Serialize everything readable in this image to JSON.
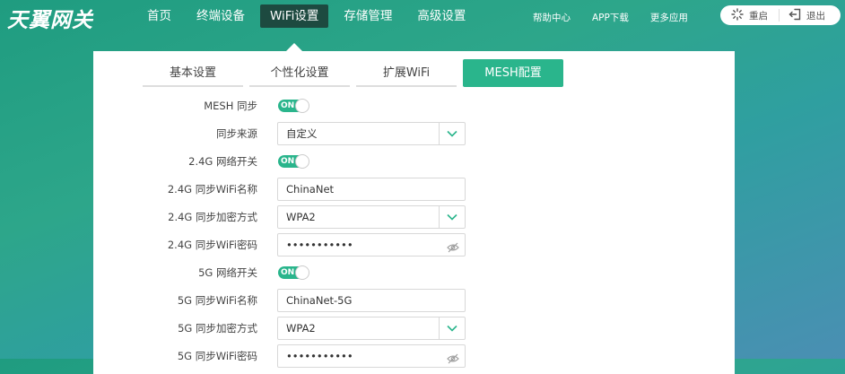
{
  "brand": {
    "logo": "天翼网关"
  },
  "nav": [
    {
      "label": "首页"
    },
    {
      "label": "终端设备"
    },
    {
      "label": "WiFi设置",
      "active": true
    },
    {
      "label": "存储管理"
    },
    {
      "label": "高级设置"
    }
  ],
  "links": [
    {
      "label": "帮助中心"
    },
    {
      "label": "APP下载"
    },
    {
      "label": "更多应用"
    }
  ],
  "actions": {
    "restart": "重启",
    "logout": "退出"
  },
  "tabs": [
    {
      "label": "基本设置"
    },
    {
      "label": "个性化设置"
    },
    {
      "label": "扩展WiFi"
    },
    {
      "label": "MESH配置",
      "active": true
    }
  ],
  "form": {
    "mesh_sync": {
      "label": "MESH 同步",
      "state": "ON"
    },
    "sync_source": {
      "label": "同步来源",
      "value": "自定义"
    },
    "wifi24_switch": {
      "label": "2.4G 网络开关",
      "state": "ON"
    },
    "wifi24_name": {
      "label": "2.4G 同步WiFi名称",
      "value": "ChinaNet"
    },
    "wifi24_enc": {
      "label": "2.4G 同步加密方式",
      "value": "WPA2"
    },
    "wifi24_pwd": {
      "label": "2.4G 同步WiFi密码",
      "value": "•••••••••••"
    },
    "wifi5_switch": {
      "label": "5G 网络开关",
      "state": "ON"
    },
    "wifi5_name": {
      "label": "5G 同步WiFi名称",
      "value": "ChinaNet-5G"
    },
    "wifi5_enc": {
      "label": "5G 同步加密方式",
      "value": "WPA2"
    },
    "wifi5_pwd": {
      "label": "5G 同步WiFi密码",
      "value": "•••••••••••"
    }
  },
  "colors": {
    "accent": "#2ab58c",
    "nav_active": "#1d4a40"
  }
}
